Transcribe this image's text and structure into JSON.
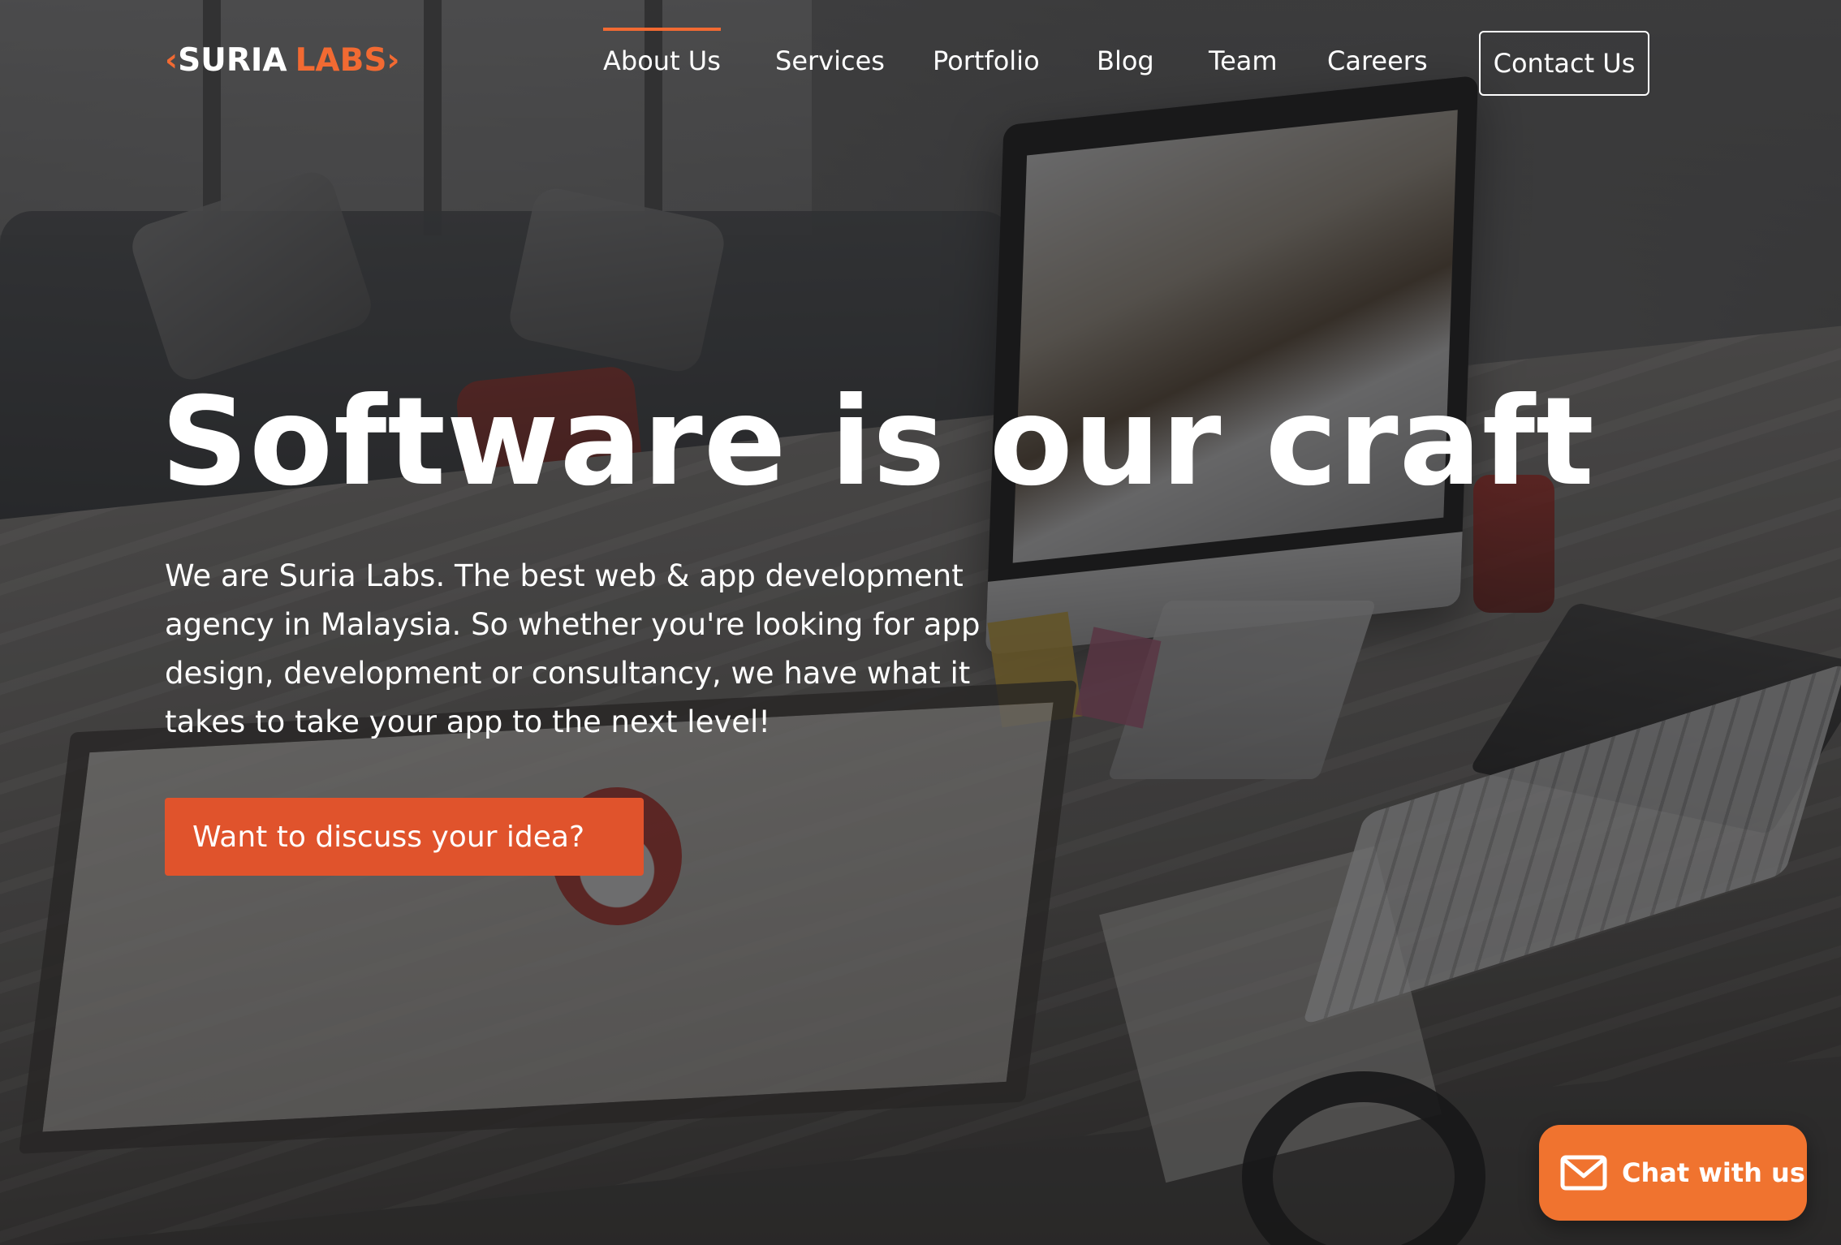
{
  "brand": {
    "logo_open": "‹",
    "logo_word1": "SURIA",
    "logo_word2": "LABS",
    "logo_close": "›",
    "accent_color": "#f26a32"
  },
  "nav": {
    "items": [
      {
        "label": "About Us",
        "active": true
      },
      {
        "label": "Services",
        "active": false
      },
      {
        "label": "Portfolio",
        "active": false
      },
      {
        "label": "Blog",
        "active": false
      },
      {
        "label": "Team",
        "active": false
      },
      {
        "label": "Careers",
        "active": false
      }
    ],
    "contact_label": "Contact Us"
  },
  "hero": {
    "title": "Software is our craft",
    "description": "We are Suria Labs. The best web & app development agency in Malaysia. So whether you're looking for app design, development or consultancy, we have what it takes to take your app to the next level!",
    "cta_label": "Want to discuss your idea?",
    "cta_color": "#e0532c"
  },
  "chat": {
    "label": "Chat with us",
    "icon": "envelope-icon",
    "color": "#f0732f"
  }
}
